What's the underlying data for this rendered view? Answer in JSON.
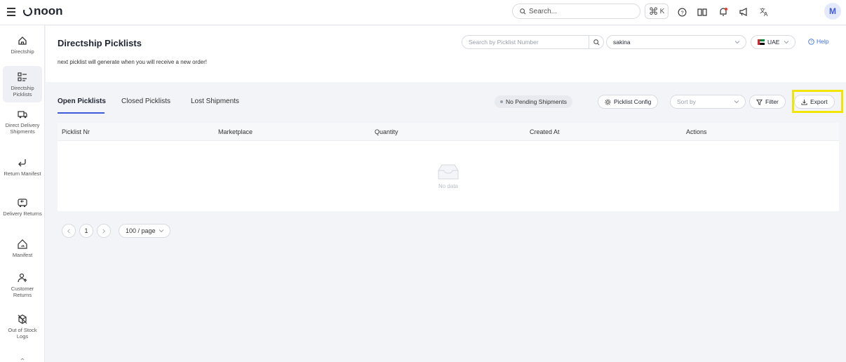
{
  "topbar": {
    "logo_text": "noon",
    "search_placeholder": "Search...",
    "shortcut_key": "K",
    "avatar_initial": "M"
  },
  "sidebar": {
    "items": [
      {
        "label": "Directship",
        "icon": "home-icon"
      },
      {
        "label": "Directship Picklists",
        "icon": "picklist-icon"
      },
      {
        "label": "Direct Delivery Shipments",
        "icon": "truck-icon"
      },
      {
        "label": "Return Manifest",
        "icon": "return-arrow-icon"
      },
      {
        "label": "Delivery Returns",
        "icon": "delivery-return-icon"
      },
      {
        "label": "Manifest",
        "icon": "manifest-house-icon"
      },
      {
        "label": "Customer Returns",
        "icon": "customer-return-icon"
      },
      {
        "label": "Out of Stock Logs",
        "icon": "out-of-stock-icon"
      }
    ]
  },
  "header": {
    "title": "Directship Picklists",
    "subtitle": "next picklist will generate when you will receive a new order!",
    "picklist_search_placeholder": "Search by Picklist Number",
    "user_value": "sakina",
    "country_value": "UAE",
    "help_label": "Help"
  },
  "tabs": [
    {
      "label": "Open Picklists",
      "active": true
    },
    {
      "label": "Closed Picklists",
      "active": false
    },
    {
      "label": "Lost Shipments",
      "active": false
    }
  ],
  "toolbar": {
    "pending_label": "No Pending Shipments",
    "config_label": "Picklist Config",
    "sort_placeholder": "Sort by",
    "filter_label": "Filter",
    "export_label": "Export"
  },
  "table": {
    "columns": [
      "Picklist Nr",
      "Marketplace",
      "Quantity",
      "Created At",
      "Actions"
    ],
    "empty_text": "No data"
  },
  "pagination": {
    "current_page": "1",
    "page_size": "100 / page"
  },
  "colors": {
    "accent": "#3d5bd9",
    "highlight": "#f2e600",
    "help_link": "#3d6ee8"
  }
}
